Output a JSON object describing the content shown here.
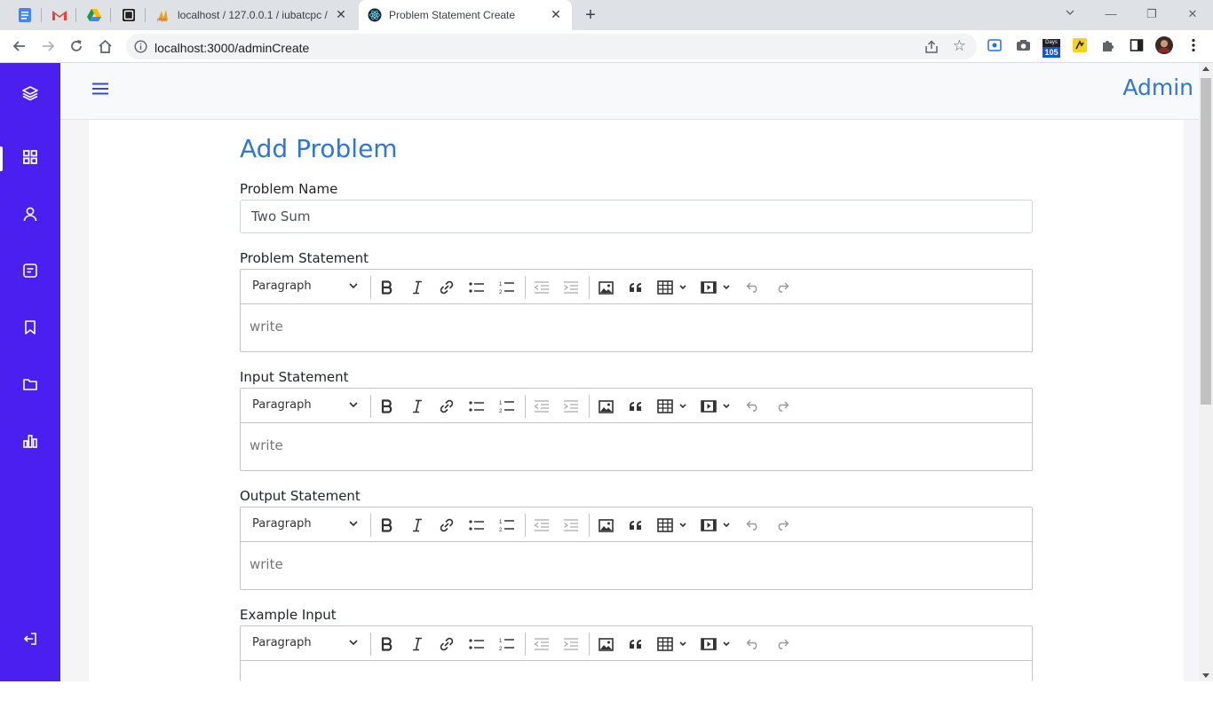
{
  "browser": {
    "tabs": [
      {
        "title": "localhost / 127.0.0.1 / iubatcpc / ",
        "icon": "phpmyadmin-icon"
      },
      {
        "title": "Problem Statement Create",
        "icon": "react-icon"
      }
    ],
    "close_glyph": "✕",
    "new_tab_glyph": "+",
    "url": "localhost:3000/adminCreate",
    "window_controls": {
      "minimize": "—",
      "restore": "❐",
      "close": "✕"
    },
    "extension_badge": "105"
  },
  "header": {
    "user_label": "Admin"
  },
  "sidebar": {
    "items": [
      {
        "icon": "layers-icon"
      },
      {
        "icon": "dashboard-grid-icon",
        "active": true
      },
      {
        "icon": "user-icon"
      },
      {
        "icon": "document-icon"
      },
      {
        "icon": "bookmark-icon"
      },
      {
        "icon": "folder-icon"
      },
      {
        "icon": "bar-chart-icon"
      },
      {
        "icon": "logout-icon"
      }
    ],
    "accent_color": "#4a1ff0"
  },
  "form": {
    "title": "Add Problem",
    "problem_name": {
      "label": "Problem Name",
      "value": "Two Sum"
    },
    "editors": [
      {
        "label": "Problem Statement",
        "block_format": "Paragraph",
        "placeholder": "write"
      },
      {
        "label": "Input Statement",
        "block_format": "Paragraph",
        "placeholder": "write"
      },
      {
        "label": "Output Statement",
        "block_format": "Paragraph",
        "placeholder": "write"
      },
      {
        "label": "Example Input",
        "block_format": "Paragraph",
        "placeholder": ""
      }
    ]
  },
  "colors": {
    "title_blue": "#2f76d8",
    "sidebar": "#4a1ff0"
  }
}
